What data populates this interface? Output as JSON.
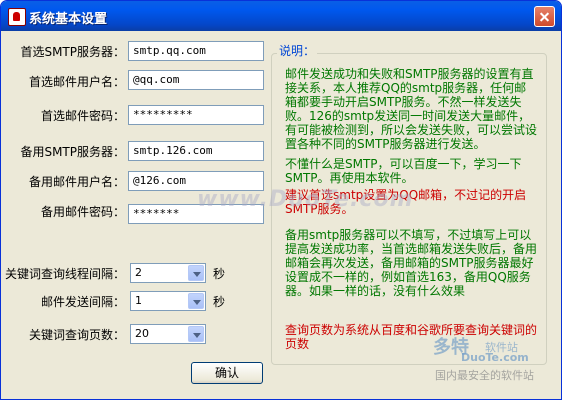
{
  "window": {
    "title": "系统基本设置"
  },
  "form": {
    "primary_smtp": {
      "label": "首选SMTP服务器：",
      "value": "smtp.qq.com"
    },
    "primary_user": {
      "label": "首选邮件用户名：",
      "value": "@qq.com"
    },
    "primary_password": {
      "label": "首选邮件密码：",
      "value": "*********"
    },
    "backup_smtp": {
      "label": "备用SMTP服务器：",
      "value": "smtp.126.com"
    },
    "backup_user": {
      "label": "备用邮件用户名：",
      "value": "@126.com"
    },
    "backup_password": {
      "label": "备用邮件密码：",
      "value": "*******"
    },
    "thread_interval": {
      "label": "关键词查询线程间隔：",
      "value": "2",
      "unit": "秒"
    },
    "send_interval": {
      "label": "邮件发送间隔：",
      "value": "1",
      "unit": "秒"
    },
    "query_pages": {
      "label": "关键词查询页数：",
      "value": "20"
    }
  },
  "help": {
    "title": "说明：",
    "para1": "邮件发送成功和失败和SMTP服务器的设置有直接关系，本人推荐QQ的smtp服务器，任何邮箱都要手动开启SMTP服务。不然一样发送失败。126的smtp发送同一时间发送大量邮件，有可能被检测到，所以会发送失败，可以尝试设置各种不同的SMTP服务器进行发送。",
    "para2": "不懂什么是SMTP，可以百度一下，学习一下SMTP。再使用本软件。",
    "para3": "建议首选smtp设置为QQ邮箱，不过记的开启SMTP服务。",
    "para4": "备用smtp服务器可以不填写，不过填写上可以提高发送成功率，当首选邮箱发送失败后，备用邮箱会再次发送，备用邮箱的SMTP服务器最好设置成不一样的，例如首选163，备用QQ服务器。如果一样的话，没有什么效果",
    "para5": "查询页数为系统从百度和谷歌所要查询关键词的页数"
  },
  "buttons": {
    "ok": "确认"
  },
  "watermarks": {
    "center": "www.DuoTe.com",
    "logo_line1": "多特",
    "logo_line2": "软件站",
    "logo_line3": "DuoTe.com",
    "logo_line4": "国内最安全的软件站"
  },
  "colors": {
    "title_bar": "#0058ee",
    "window_bg": "#ece9d8",
    "help_text": "#007700",
    "help_highlight": "#cc0000",
    "help_title": "#0046d5"
  }
}
